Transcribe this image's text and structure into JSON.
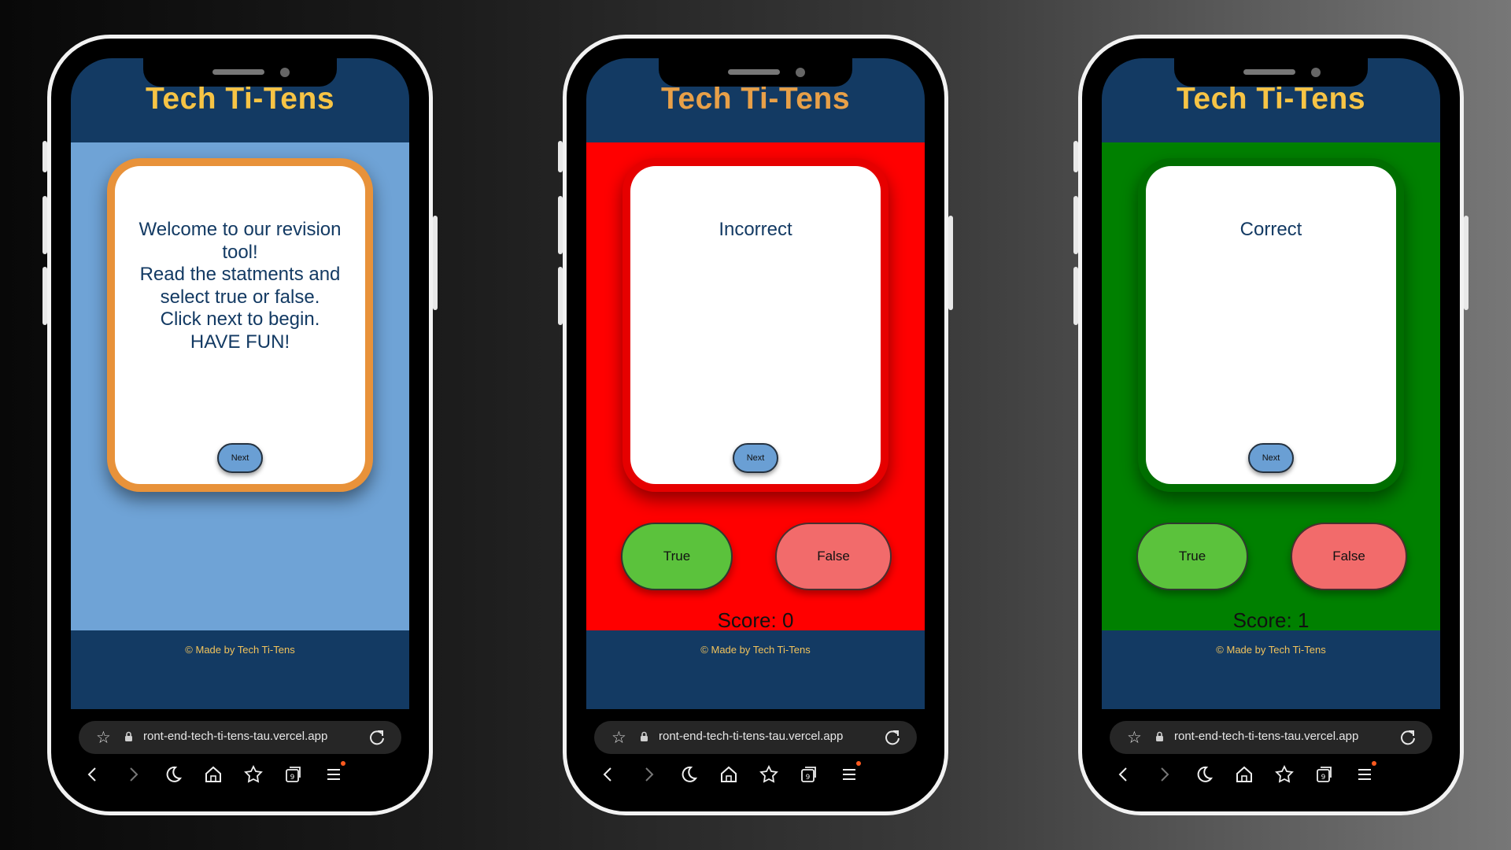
{
  "app": {
    "title": "Tech Ti-Tens",
    "footer": "© Made by Tech Ti-Tens"
  },
  "browser": {
    "url": "ront-end-tech-ti-tens-tau.vercel.app",
    "icons": [
      "star-icon",
      "lock-icon",
      "reload-icon",
      "back-icon",
      "forward-icon",
      "moon-icon",
      "home-icon",
      "bookmarks-icon",
      "tabs-icon",
      "menu-icon"
    ],
    "tab_count": "9"
  },
  "colors": {
    "header_bg": "#133a63",
    "title_yellow": "#f7c445",
    "title_orange": "#e8a048",
    "welcome_bg": "#6fa3d6",
    "welcome_frame": "#e8923a",
    "incorrect_bg": "#ff0000",
    "correct_bg": "#008000",
    "true_button": "#5bc23c",
    "false_button": "#f26b6b",
    "next_button": "#6a9fd4"
  },
  "screens": [
    {
      "state": "welcome",
      "card_lines": [
        "Welcome to our revision",
        "tool!",
        "Read the statments and",
        "select true or false.",
        "Click next to begin.",
        "HAVE FUN!"
      ],
      "next_label": "Next"
    },
    {
      "state": "incorrect",
      "card_lines": [
        "Incorrect"
      ],
      "next_label": "Next",
      "true_label": "True",
      "false_label": "False",
      "score_text": "Score: 0"
    },
    {
      "state": "correct",
      "card_lines": [
        "Correct"
      ],
      "next_label": "Next",
      "true_label": "True",
      "false_label": "False",
      "score_text": "Score: 1"
    }
  ]
}
